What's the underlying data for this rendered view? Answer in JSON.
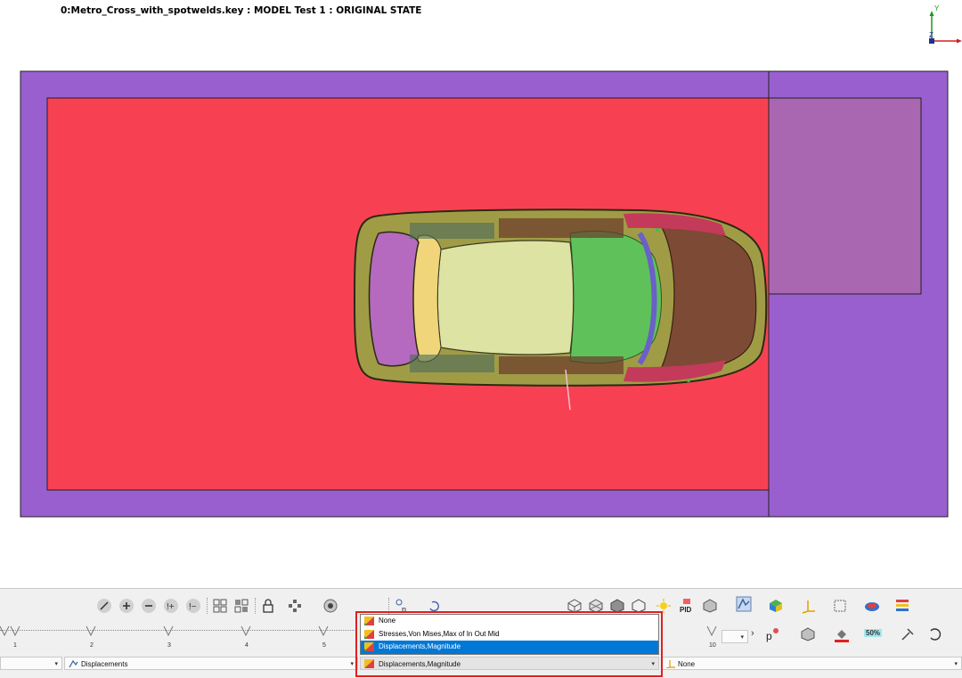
{
  "header": {
    "title": "0:Metro_Cross_with_spotwelds.key  : MODEL Test 1  : ORIGINAL STATE"
  },
  "axis": {
    "y_label": "Y",
    "z_label": "Z",
    "x_label": "X"
  },
  "colors": {
    "ground": "#9a5fcf",
    "floor": "#f74153",
    "panel": "#a867b0",
    "highlight": "#e02020",
    "selection": "#0078d7"
  },
  "timeline": {
    "ticks": [
      "1",
      "2",
      "3",
      "4",
      "5",
      "10"
    ]
  },
  "toolbar": {
    "left_combo_value": "",
    "result_combo_value": "Displacements",
    "component_dropdown": {
      "options": [
        "None",
        "Stresses,Von Mises,Max of In Out Mid",
        "Displacements,Magnitude"
      ],
      "selected": "Displacements,Magnitude"
    },
    "vector_combo_value": "None",
    "transparency_label": "50%",
    "icons": [
      "line-icon",
      "zoom-in-icon",
      "zoom-out-icon",
      "select-add-icon",
      "deselect-icon",
      "grid-view-icon",
      "grid-view-alt-icon",
      "lock-icon",
      "node-pick-icon",
      "element-pick-icon",
      "probe-icon",
      "rotate-icon",
      "iso-view-icon",
      "wireframe-icon",
      "shaded-icon",
      "outline-icon",
      "light-icon",
      "pid-icon",
      "part-color-icon",
      "fringe-icon",
      "color-cube-icon",
      "axis-icon",
      "clip-plane-icon",
      "contour-icon",
      "legend-icon",
      "p-icon",
      "part-icon",
      "fill-icon",
      "transparency-icon",
      "pin-icon",
      "undo-icon"
    ]
  }
}
